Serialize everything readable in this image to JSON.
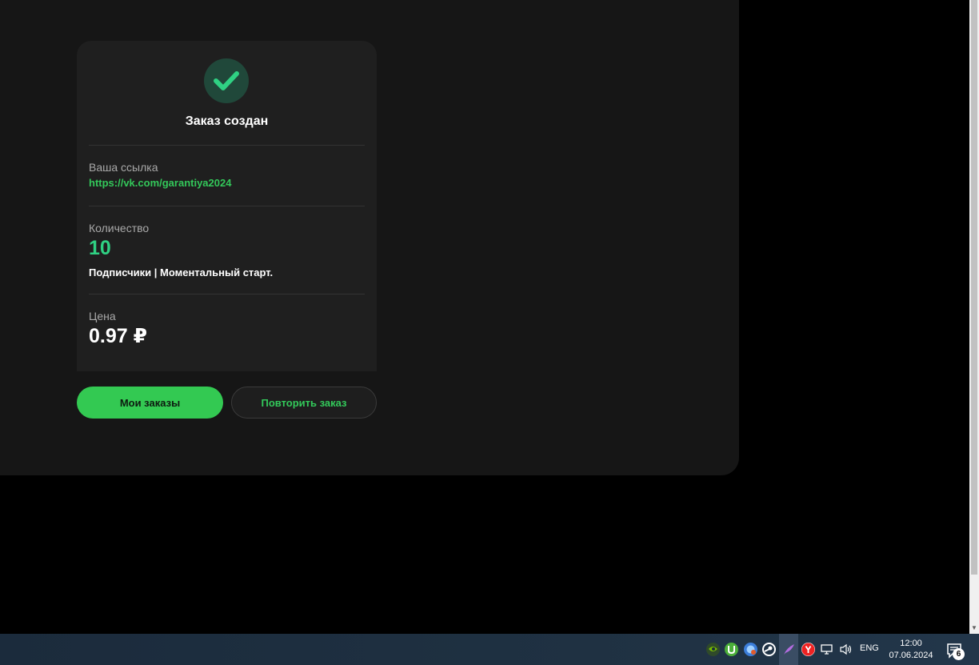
{
  "order": {
    "title": "Заказ создан",
    "link_label": "Ваша ссылка",
    "link_value": "https://vk.com/garantiya2024",
    "quantity_label": "Количество",
    "quantity_value": "10",
    "service_name": "Подписчики | Моментальный старт.",
    "price_label": "Цена",
    "price_value": "0.97 ₽"
  },
  "actions": {
    "my_orders": "Мои заказы",
    "repeat_order": "Повторить заказ"
  },
  "taskbar": {
    "tray_icons": [
      "nvidia-icon",
      "utorrent-icon",
      "browser-update-icon",
      "steam-icon",
      "feather-icon",
      "yandex-browser-icon",
      "network-icon",
      "volume-icon"
    ],
    "language": "ENG",
    "time": "12:00",
    "date": "07.06.2024",
    "notifications_count": "6"
  },
  "colors": {
    "accent": "#33c952",
    "success_number": "#2fd183",
    "card_bg": "#1f1f1f",
    "panel_bg": "#161616"
  }
}
